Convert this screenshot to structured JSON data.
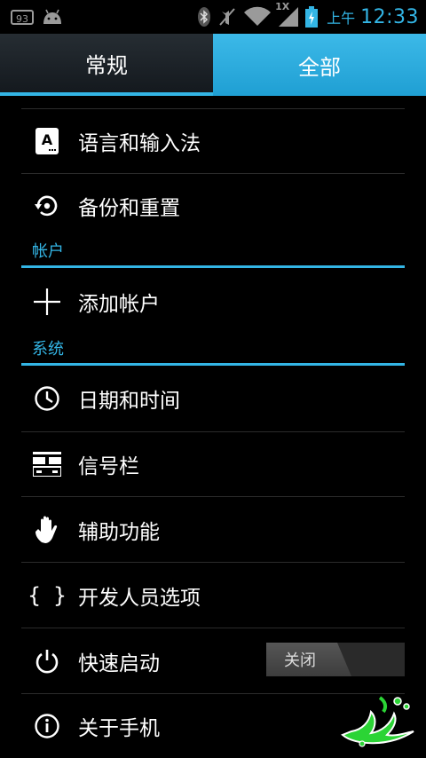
{
  "status_bar": {
    "notification_count": "93",
    "ampm": "上午",
    "time": "12:33",
    "network_type": "1X",
    "icons": [
      "notification-badge-icon",
      "android-icon",
      "bluetooth-icon",
      "mute-icon",
      "wifi-icon",
      "signal-icon",
      "battery-charging-icon"
    ]
  },
  "tabs": {
    "general": "常规",
    "all": "全部"
  },
  "items_top": [
    {
      "label": "语言和输入法",
      "icon": "keyboard-icon"
    },
    {
      "label": "备份和重置",
      "icon": "backup-restore-icon"
    }
  ],
  "section_accounts": {
    "title": "帐户",
    "items": [
      {
        "label": "添加帐户",
        "icon": "plus-icon"
      }
    ]
  },
  "section_system": {
    "title": "系统",
    "items": [
      {
        "label": "日期和时间",
        "icon": "clock-icon"
      },
      {
        "label": "信号栏",
        "icon": "status-bar-icon"
      },
      {
        "label": "辅助功能",
        "icon": "hand-icon"
      },
      {
        "label": "开发人员选项",
        "icon": "braces-icon",
        "icon_text": "{ }"
      },
      {
        "label": "快速启动",
        "icon": "power-icon",
        "toggle_label": "关闭"
      },
      {
        "label": "关于手机",
        "icon": "info-icon"
      }
    ]
  },
  "colors": {
    "accent": "#33b5e5",
    "background": "#000000"
  }
}
